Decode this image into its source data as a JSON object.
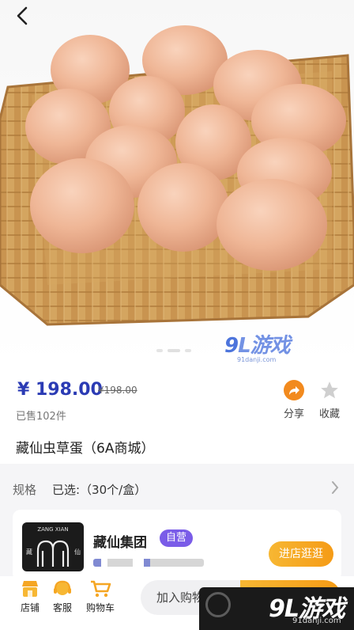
{
  "nav": {
    "back_icon": "chevron-left-icon"
  },
  "hero": {
    "watermark_logo_a": "9",
    "watermark_logo_b": "L",
    "watermark_logo_c": "游戏",
    "watermark_url": "91danji.com",
    "carousel_total": 3,
    "carousel_active": 1
  },
  "product": {
    "price": "¥ 198.00",
    "original_price": "¥198.00",
    "sold": "已售102件",
    "title": "藏仙虫草蛋（6A商城）",
    "share_label": "分享",
    "favorite_label": "收藏"
  },
  "spec": {
    "label": "规格",
    "value": "已选:（30个/盒）"
  },
  "store": {
    "name": "藏仙集团",
    "badge": "自营",
    "enter_label": "进店逛逛",
    "logo_text_top": "ZANG XIAN",
    "logo_text_left": "藏",
    "logo_text_right": "仙"
  },
  "bottom_bar": {
    "shop_label": "店铺",
    "service_label": "客服",
    "cart_label": "购物车",
    "add_to_cart_label": "加入购物车"
  },
  "watermark2": {
    "logo_a": "9",
    "logo_b": "L",
    "logo_c": "游戏",
    "url": "91danji.com"
  },
  "colors": {
    "price": "#2b3bb4",
    "accent_orange": "#f59b16",
    "badge_purple": "#7a5ce8",
    "share_orange": "#f28a1e"
  }
}
